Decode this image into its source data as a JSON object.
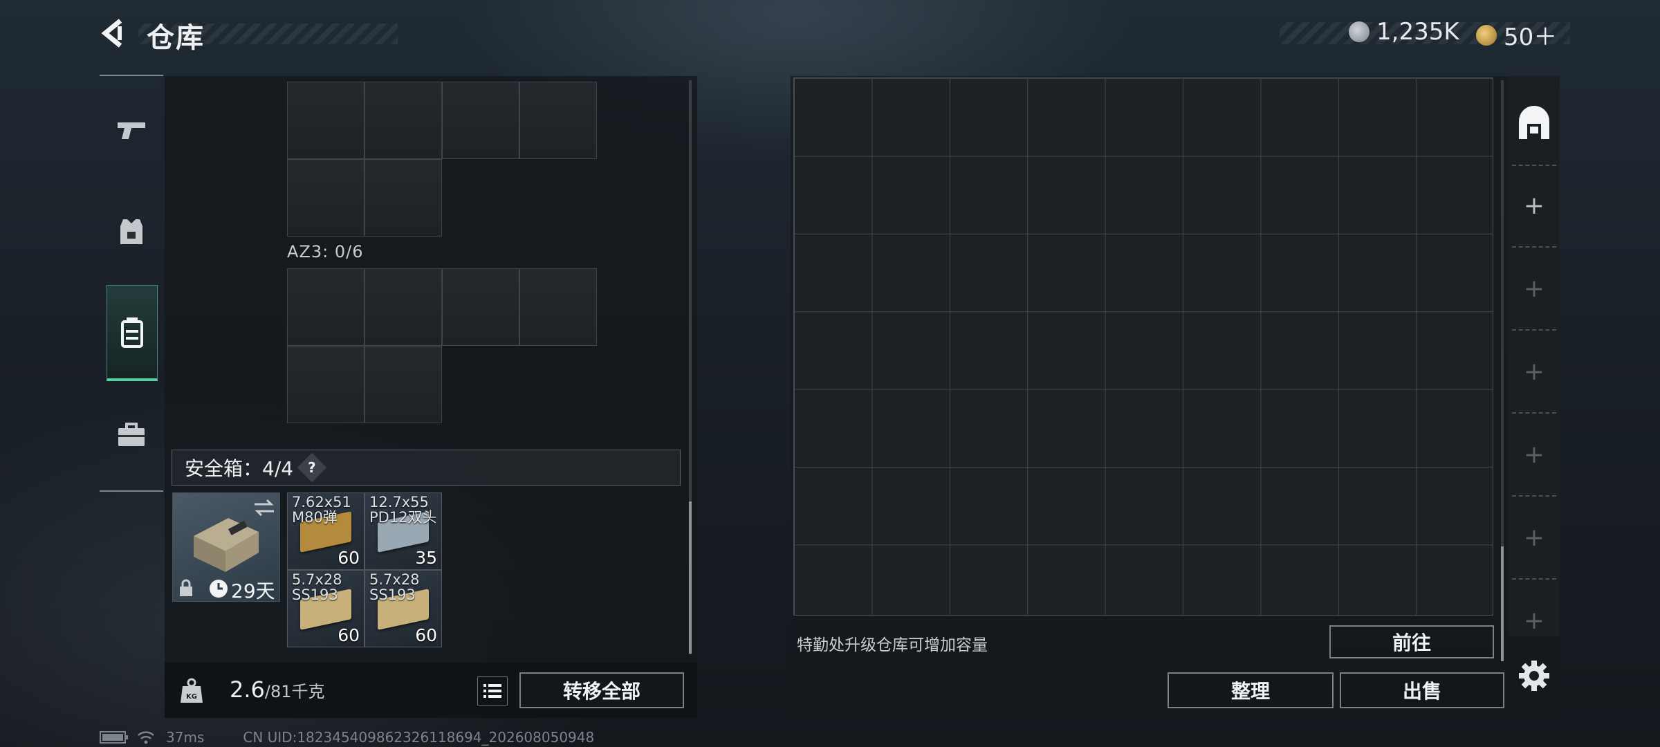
{
  "header": {
    "title": "仓库"
  },
  "currency": {
    "silver": "1,235K",
    "gold": "50＋"
  },
  "left": {
    "container_label": "AZ3: 0/6",
    "safebox": {
      "label": "安全箱：4/4",
      "help": "?",
      "duration": "29天"
    },
    "ammo": [
      {
        "name": "7.62x51\nM80弹",
        "count": "60",
        "color": "#b48a3c"
      },
      {
        "name": "12.7x55\nPD12双头",
        "count": "35",
        "color": "#9aa8b4"
      },
      {
        "name": "5.7x28\nSS193",
        "count": "60",
        "color": "#c7b07a"
      },
      {
        "name": "5.7x28\nSS193",
        "count": "60",
        "color": "#c7b07a"
      }
    ],
    "weight": "2.6",
    "weight_max": "/81千克",
    "transfer_all": "转移全部"
  },
  "right": {
    "hint": "特勤处升级仓库可增加容量",
    "goto": "前往",
    "sort": "整理",
    "sell": "出售",
    "side_slots": [
      "+",
      "+",
      "+",
      "+",
      "+",
      "+"
    ]
  },
  "footer": {
    "ping": "37ms",
    "uid": "CN UID:1823454098623261186​94_202608050948"
  },
  "colors": {
    "accent": "#55d49a"
  }
}
